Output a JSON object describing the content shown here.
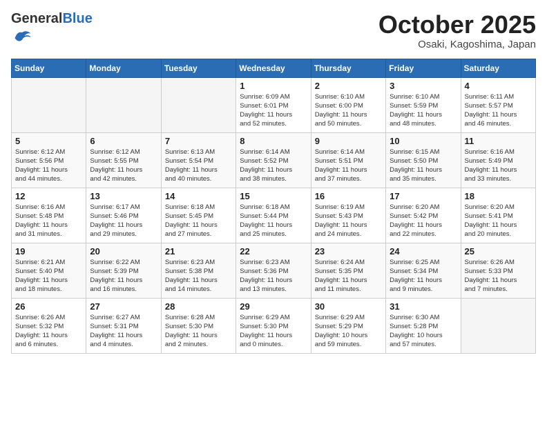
{
  "header": {
    "logo_general": "General",
    "logo_blue": "Blue",
    "month": "October 2025",
    "location": "Osaki, Kagoshima, Japan"
  },
  "columns": [
    "Sunday",
    "Monday",
    "Tuesday",
    "Wednesday",
    "Thursday",
    "Friday",
    "Saturday"
  ],
  "weeks": [
    [
      {
        "day": "",
        "info": ""
      },
      {
        "day": "",
        "info": ""
      },
      {
        "day": "",
        "info": ""
      },
      {
        "day": "1",
        "info": "Sunrise: 6:09 AM\nSunset: 6:01 PM\nDaylight: 11 hours\nand 52 minutes."
      },
      {
        "day": "2",
        "info": "Sunrise: 6:10 AM\nSunset: 6:00 PM\nDaylight: 11 hours\nand 50 minutes."
      },
      {
        "day": "3",
        "info": "Sunrise: 6:10 AM\nSunset: 5:59 PM\nDaylight: 11 hours\nand 48 minutes."
      },
      {
        "day": "4",
        "info": "Sunrise: 6:11 AM\nSunset: 5:57 PM\nDaylight: 11 hours\nand 46 minutes."
      }
    ],
    [
      {
        "day": "5",
        "info": "Sunrise: 6:12 AM\nSunset: 5:56 PM\nDaylight: 11 hours\nand 44 minutes."
      },
      {
        "day": "6",
        "info": "Sunrise: 6:12 AM\nSunset: 5:55 PM\nDaylight: 11 hours\nand 42 minutes."
      },
      {
        "day": "7",
        "info": "Sunrise: 6:13 AM\nSunset: 5:54 PM\nDaylight: 11 hours\nand 40 minutes."
      },
      {
        "day": "8",
        "info": "Sunrise: 6:14 AM\nSunset: 5:52 PM\nDaylight: 11 hours\nand 38 minutes."
      },
      {
        "day": "9",
        "info": "Sunrise: 6:14 AM\nSunset: 5:51 PM\nDaylight: 11 hours\nand 37 minutes."
      },
      {
        "day": "10",
        "info": "Sunrise: 6:15 AM\nSunset: 5:50 PM\nDaylight: 11 hours\nand 35 minutes."
      },
      {
        "day": "11",
        "info": "Sunrise: 6:16 AM\nSunset: 5:49 PM\nDaylight: 11 hours\nand 33 minutes."
      }
    ],
    [
      {
        "day": "12",
        "info": "Sunrise: 6:16 AM\nSunset: 5:48 PM\nDaylight: 11 hours\nand 31 minutes."
      },
      {
        "day": "13",
        "info": "Sunrise: 6:17 AM\nSunset: 5:46 PM\nDaylight: 11 hours\nand 29 minutes."
      },
      {
        "day": "14",
        "info": "Sunrise: 6:18 AM\nSunset: 5:45 PM\nDaylight: 11 hours\nand 27 minutes."
      },
      {
        "day": "15",
        "info": "Sunrise: 6:18 AM\nSunset: 5:44 PM\nDaylight: 11 hours\nand 25 minutes."
      },
      {
        "day": "16",
        "info": "Sunrise: 6:19 AM\nSunset: 5:43 PM\nDaylight: 11 hours\nand 24 minutes."
      },
      {
        "day": "17",
        "info": "Sunrise: 6:20 AM\nSunset: 5:42 PM\nDaylight: 11 hours\nand 22 minutes."
      },
      {
        "day": "18",
        "info": "Sunrise: 6:20 AM\nSunset: 5:41 PM\nDaylight: 11 hours\nand 20 minutes."
      }
    ],
    [
      {
        "day": "19",
        "info": "Sunrise: 6:21 AM\nSunset: 5:40 PM\nDaylight: 11 hours\nand 18 minutes."
      },
      {
        "day": "20",
        "info": "Sunrise: 6:22 AM\nSunset: 5:39 PM\nDaylight: 11 hours\nand 16 minutes."
      },
      {
        "day": "21",
        "info": "Sunrise: 6:23 AM\nSunset: 5:38 PM\nDaylight: 11 hours\nand 14 minutes."
      },
      {
        "day": "22",
        "info": "Sunrise: 6:23 AM\nSunset: 5:36 PM\nDaylight: 11 hours\nand 13 minutes."
      },
      {
        "day": "23",
        "info": "Sunrise: 6:24 AM\nSunset: 5:35 PM\nDaylight: 11 hours\nand 11 minutes."
      },
      {
        "day": "24",
        "info": "Sunrise: 6:25 AM\nSunset: 5:34 PM\nDaylight: 11 hours\nand 9 minutes."
      },
      {
        "day": "25",
        "info": "Sunrise: 6:26 AM\nSunset: 5:33 PM\nDaylight: 11 hours\nand 7 minutes."
      }
    ],
    [
      {
        "day": "26",
        "info": "Sunrise: 6:26 AM\nSunset: 5:32 PM\nDaylight: 11 hours\nand 6 minutes."
      },
      {
        "day": "27",
        "info": "Sunrise: 6:27 AM\nSunset: 5:31 PM\nDaylight: 11 hours\nand 4 minutes."
      },
      {
        "day": "28",
        "info": "Sunrise: 6:28 AM\nSunset: 5:30 PM\nDaylight: 11 hours\nand 2 minutes."
      },
      {
        "day": "29",
        "info": "Sunrise: 6:29 AM\nSunset: 5:30 PM\nDaylight: 11 hours\nand 0 minutes."
      },
      {
        "day": "30",
        "info": "Sunrise: 6:29 AM\nSunset: 5:29 PM\nDaylight: 10 hours\nand 59 minutes."
      },
      {
        "day": "31",
        "info": "Sunrise: 6:30 AM\nSunset: 5:28 PM\nDaylight: 10 hours\nand 57 minutes."
      },
      {
        "day": "",
        "info": ""
      }
    ]
  ]
}
